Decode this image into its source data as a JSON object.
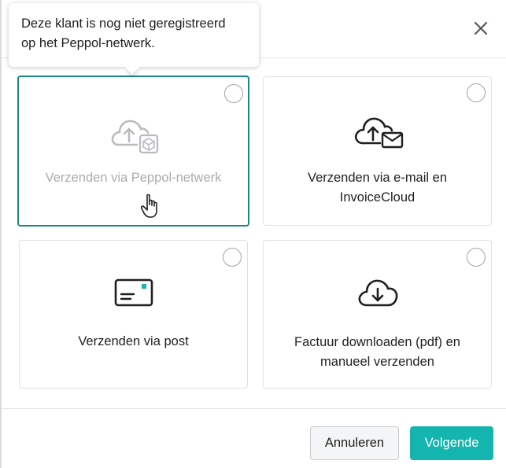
{
  "tooltip": {
    "text_line1": "Deze klant is nog niet geregistreerd",
    "text_line2": "op het Peppol-netwerk."
  },
  "options": {
    "peppol": {
      "label": "Verzenden via Peppol-netwerk",
      "icon": "cloud-upload-peppol-icon",
      "state": "disabled"
    },
    "email": {
      "label_line1": "Verzenden via e-mail en",
      "label_line2": "InvoiceCloud",
      "icon": "cloud-upload-mail-icon"
    },
    "post": {
      "label": "Verzenden via post",
      "icon": "envelope-icon"
    },
    "pdf": {
      "label_line1": "Factuur downloaden (pdf) en",
      "label_line2": "manueel verzenden",
      "icon": "cloud-download-icon"
    }
  },
  "footer": {
    "cancel_label": "Annuleren",
    "next_label": "Volgende"
  },
  "colors": {
    "accent": "#13b5ae",
    "selected_border": "#1a8a86",
    "disabled_text": "#a9acaf"
  }
}
